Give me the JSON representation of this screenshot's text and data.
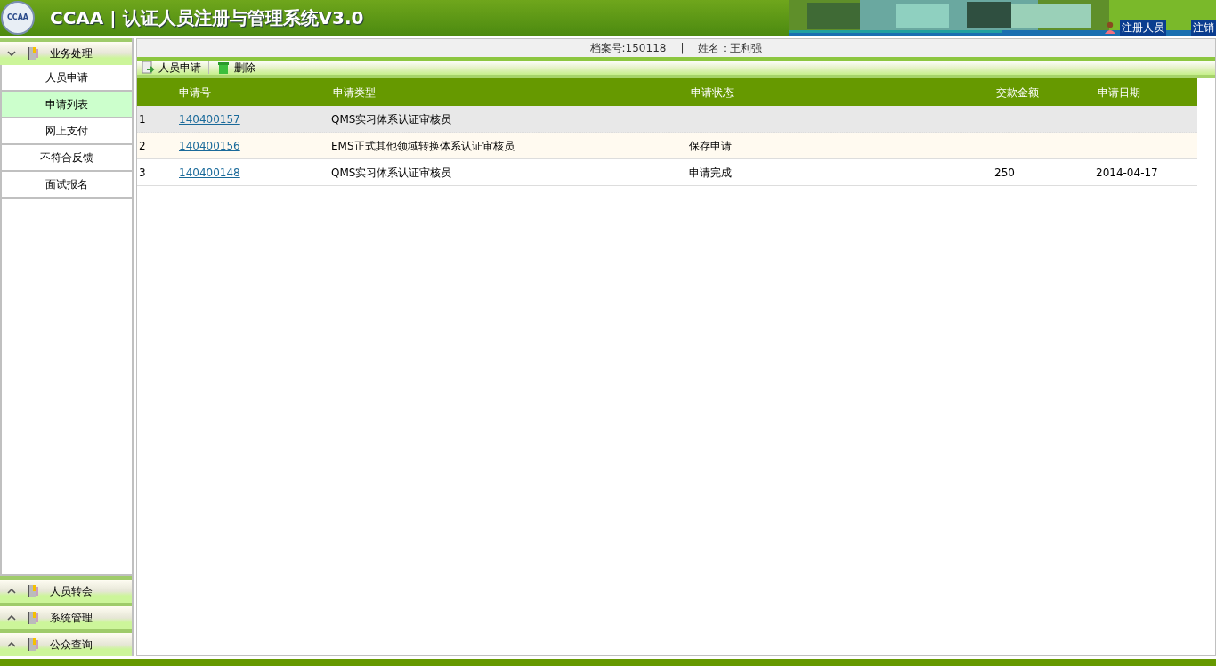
{
  "header": {
    "logo": "CCAA",
    "title": "CCAA | 认证人员注册与管理系统V3.0",
    "user_role": "注册人员",
    "logout": "注销"
  },
  "sidebar": {
    "groups": [
      {
        "label": "业务处理",
        "expanded": true,
        "items": [
          {
            "label": "人员申请",
            "selected": false
          },
          {
            "label": "申请列表",
            "selected": true
          },
          {
            "label": "网上支付",
            "selected": false
          },
          {
            "label": "不符合反馈",
            "selected": false
          },
          {
            "label": "面试报名",
            "selected": false
          }
        ]
      },
      {
        "label": "人员转会",
        "expanded": false
      },
      {
        "label": "系统管理",
        "expanded": false
      },
      {
        "label": "公众查询",
        "expanded": false
      }
    ]
  },
  "info_bar": {
    "file_no": "档案号:150118",
    "separator": "|",
    "name": "姓名：王利强"
  },
  "toolbar": [
    {
      "label": "人员申请",
      "kind": "add"
    },
    {
      "label": "删除",
      "kind": "delete"
    }
  ],
  "table": {
    "columns": [
      "申请号",
      "申请类型",
      "申请状态",
      "交款金额",
      "申请日期"
    ],
    "rows": [
      {
        "index": "1",
        "number": "140400157",
        "type": "QMS实习体系认证审核员",
        "selected": true
      },
      {
        "index": "2",
        "number": "140400156",
        "type": "EMS正式其他领域转换体系认证审核员",
        "status": "保存申请",
        "selected": false
      },
      {
        "index": "3",
        "number": "140400148",
        "type": "QMS实习体系认证审核员",
        "status": "申请完成",
        "amount": "250",
        "date": "2014-04-17",
        "selected": false
      }
    ]
  }
}
